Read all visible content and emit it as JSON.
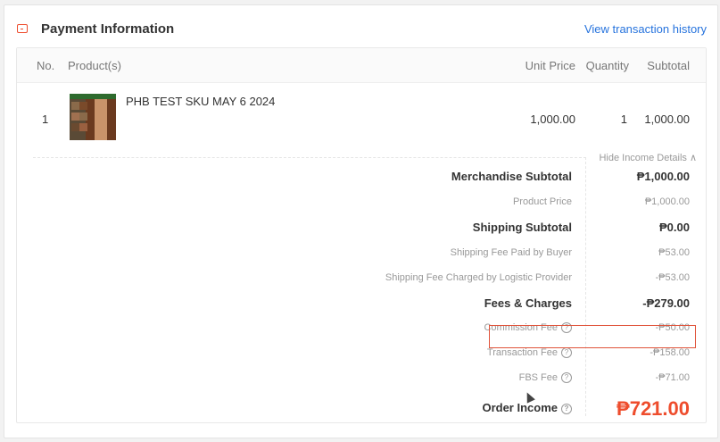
{
  "header": {
    "title": "Payment Information",
    "view_history": "View transaction history"
  },
  "table": {
    "columns": {
      "no": "No.",
      "product": "Product(s)",
      "unit_price": "Unit Price",
      "quantity": "Quantity",
      "subtotal": "Subtotal"
    },
    "item": {
      "no": "1",
      "name": "PHB TEST SKU MAY 6 2024",
      "unit_price": "1,000.00",
      "quantity": "1",
      "subtotal": "1,000.00"
    }
  },
  "income": {
    "toggle": "Hide Income Details ∧",
    "merchandise_subtotal": {
      "label": "Merchandise Subtotal",
      "value": "₱1,000.00"
    },
    "product_price": {
      "label": "Product Price",
      "value": "₱1,000.00"
    },
    "shipping_subtotal": {
      "label": "Shipping Subtotal",
      "value": "₱0.00"
    },
    "shipping_paid_buyer": {
      "label": "Shipping Fee Paid by Buyer",
      "value": "₱53.00"
    },
    "shipping_charged_logistic": {
      "label": "Shipping Fee Charged by Logistic Provider",
      "value": "-₱53.00"
    },
    "fees_charges": {
      "label": "Fees & Charges",
      "value": "-₱279.00"
    },
    "commission_fee": {
      "label": "Commission Fee",
      "value": "-₱50.00"
    },
    "transaction_fee": {
      "label": "Transaction Fee",
      "value": "-₱158.00"
    },
    "fbs_fee": {
      "label": "FBS Fee",
      "value": "-₱71.00"
    },
    "order_income": {
      "label": "Order Income",
      "value": "₱721.00"
    }
  },
  "icons": {
    "payment": "payment-card-icon",
    "help": "question-circle-icon"
  },
  "colors": {
    "accent": "#ee4d2d",
    "link": "#2673dd"
  }
}
